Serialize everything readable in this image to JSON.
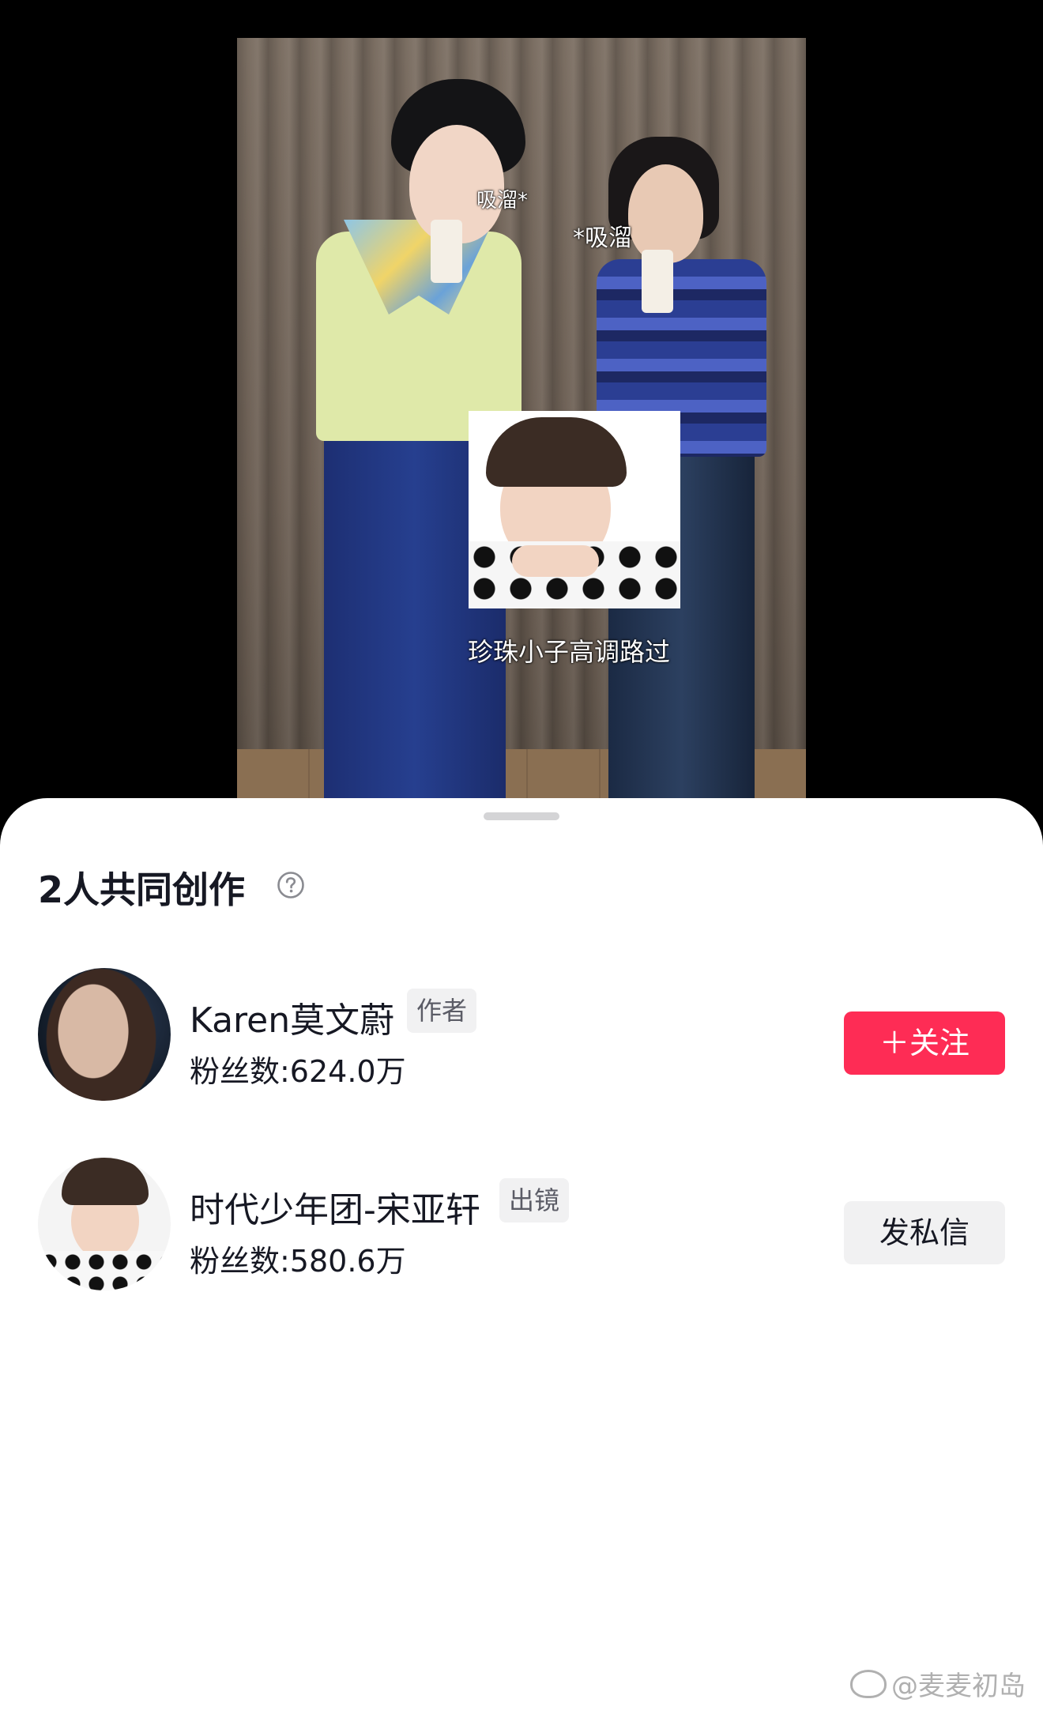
{
  "video": {
    "caption_sip_left": "吸溜*",
    "caption_sip_right": "*吸溜",
    "caption_overlay": "珍珠小子高调路过"
  },
  "sheet": {
    "title": "2人共同创作",
    "help_icon": "question-circle-icon",
    "creators": [
      {
        "name": "Karen莫文蔚",
        "role": "作者",
        "fans": "粉丝数:624.0万",
        "action": "＋关注",
        "action_color": "#fe2c55"
      },
      {
        "name": "时代少年团-宋亚轩",
        "role": "出镜",
        "fans": "粉丝数:580.6万",
        "action": "发私信"
      }
    ]
  },
  "watermark": {
    "text": "@麦麦初岛",
    "icon": "weibo-icon"
  }
}
